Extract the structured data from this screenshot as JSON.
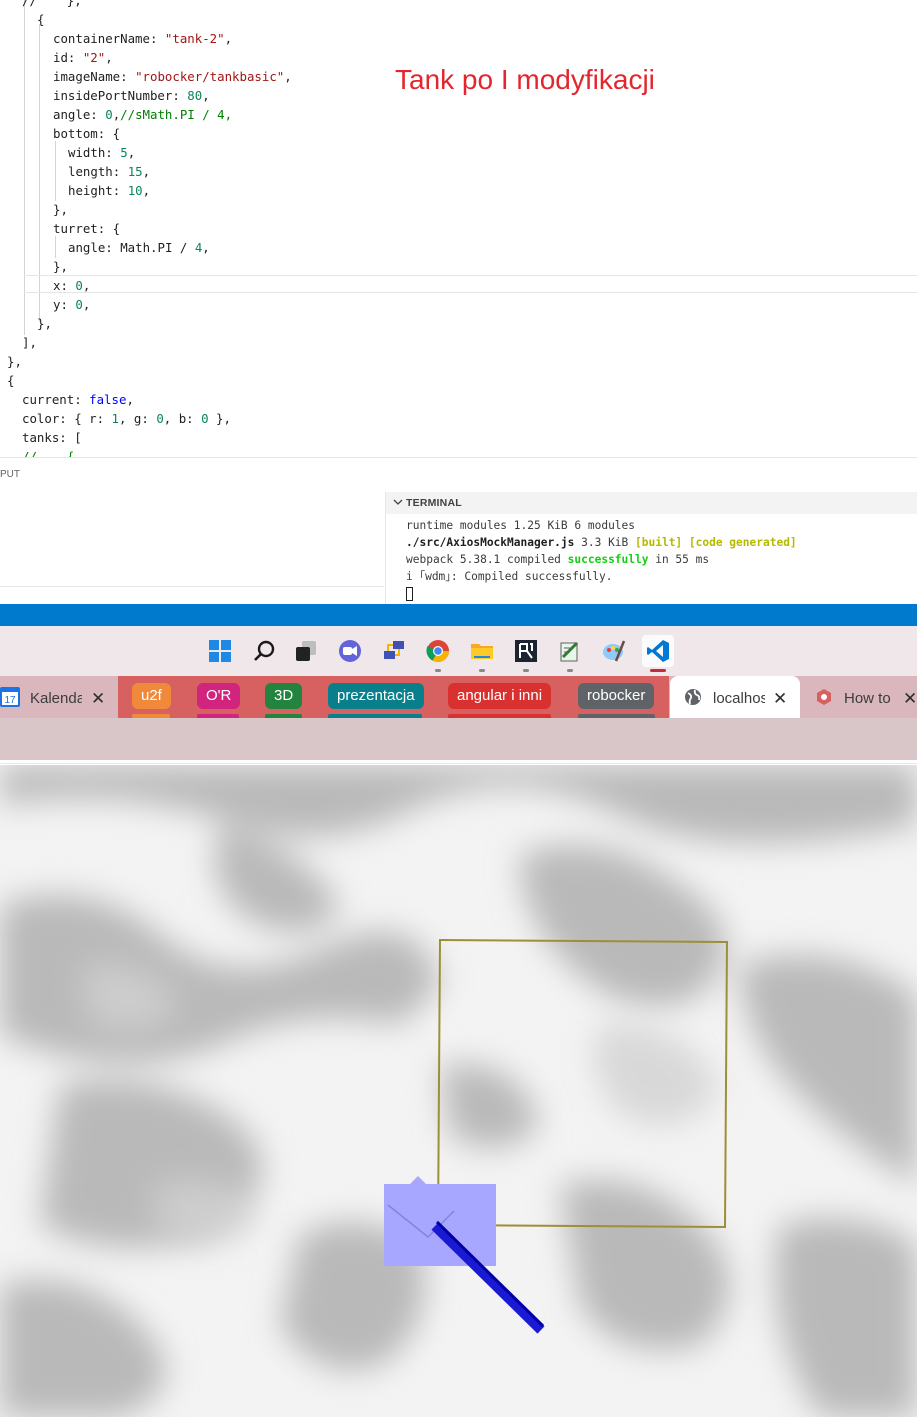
{
  "editor": {
    "lines": [
      [
        "//    },"
      ],
      [
        "{"
      ],
      [
        "containerName: ",
        {
          "t": "\"tank-2\"",
          "c": "s"
        },
        ","
      ],
      [
        "id: ",
        {
          "t": "\"2\"",
          "c": "s"
        },
        ","
      ],
      [
        "imageName: ",
        {
          "t": "\"robocker/tankbasic\"",
          "c": "s"
        },
        ","
      ],
      [
        "insidePortNumber: ",
        {
          "t": "80",
          "c": "n"
        },
        ","
      ],
      [
        "angle: ",
        {
          "t": "0",
          "c": "n"
        },
        ",",
        {
          "t": "//sMath.PI / 4,",
          "c": "c"
        }
      ],
      [
        "bottom: {"
      ],
      [
        "width: ",
        {
          "t": "5",
          "c": "n"
        },
        ","
      ],
      [
        "length: ",
        {
          "t": "15",
          "c": "n"
        },
        ","
      ],
      [
        "height: ",
        {
          "t": "10",
          "c": "n"
        },
        ","
      ],
      [
        "},"
      ],
      [
        "turret: {"
      ],
      [
        "angle: Math.PI / ",
        {
          "t": "4",
          "c": "n"
        },
        ","
      ],
      [
        "},"
      ],
      [
        "x: ",
        {
          "t": "0",
          "c": "n"
        },
        ","
      ],
      [
        "y: ",
        {
          "t": "0",
          "c": "n"
        },
        ","
      ],
      [
        "},"
      ],
      [
        "],"
      ],
      [
        "},"
      ],
      [
        "{"
      ],
      [
        "current: ",
        {
          "t": "false",
          "c": "k"
        },
        ","
      ],
      [
        "color: { r: ",
        {
          "t": "1",
          "c": "n"
        },
        ", g: ",
        {
          "t": "0",
          "c": "n"
        },
        ", b: ",
        {
          "t": "0",
          "c": "n"
        },
        " },"
      ],
      [
        "tanks: ["
      ],
      [
        {
          "t": "//    {",
          "c": "c"
        }
      ]
    ],
    "annotation": "Tank po I modyfikacji"
  },
  "panel": {
    "output_label": "PUT",
    "terminal_title": "TERMINAL",
    "terminal_lines": [
      [
        "runtime modules 1.25 KiB 6 modules"
      ],
      [
        {
          "t": "./src/AxiosMockManager.js",
          "c": "b"
        },
        " 3.3 KiB ",
        {
          "t": "[built] [code generated]",
          "c": "y"
        }
      ],
      [
        "webpack 5.38.1 compiled ",
        {
          "t": "successfully",
          "c": "g"
        },
        " in 55 ms"
      ],
      [
        {
          "t": "i",
          "c": "bl"
        },
        " ｢wdm｣: Compiled successfully."
      ]
    ]
  },
  "taskbar": {
    "icons": [
      "windows-start-icon",
      "search-icon",
      "task-view-icon",
      "chat-icon",
      "network-icon",
      "chrome-icon",
      "file-explorer-icon",
      "app-icon",
      "notepad-icon",
      "paint-icon",
      "vscode-icon"
    ]
  },
  "browser": {
    "tabs": {
      "calendar": "Kalenda",
      "u2f": "u2f",
      "or": "O'R",
      "three_d": "3D",
      "prezentacja": "prezentacja",
      "angular": "angular i inni",
      "robocker": "robocker",
      "localhost": "localhos",
      "howto": "How to"
    },
    "calendar_day": "17",
    "colors": {
      "u2f": "#f0893a",
      "or": "#d0247e",
      "three_d": "#22843f",
      "prezentacja": "#0a7f8c",
      "angular": "#d8312f",
      "robocker": "#5f6368"
    }
  }
}
